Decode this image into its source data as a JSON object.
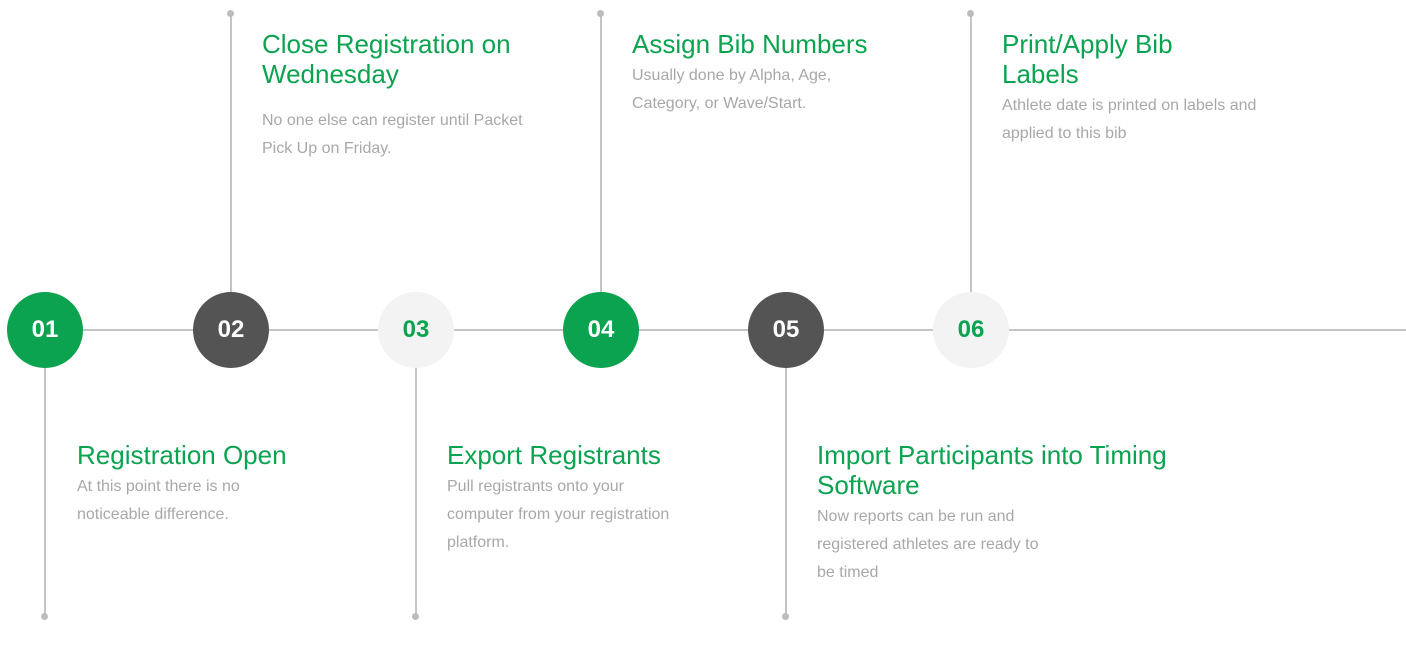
{
  "colors": {
    "green": "#0ba350",
    "dark": "#545454",
    "light": "#f3f3f3",
    "line": "#c4c4c4",
    "title_text": "#0ba350",
    "desc_text": "#a8a8a8"
  },
  "steps": [
    {
      "number": "01",
      "style": "green",
      "title": "Registration Open",
      "description": "At this point there is no noticeable difference."
    },
    {
      "number": "02",
      "style": "dark",
      "title": "Close Registration on Wednesday",
      "description": "No one else can register until Packet Pick Up on Friday."
    },
    {
      "number": "03",
      "style": "light",
      "title": "Export Registrants",
      "description": "Pull registrants onto your computer from your registration platform."
    },
    {
      "number": "04",
      "style": "green",
      "title": "Assign Bib Numbers",
      "description": "Usually done by Alpha, Age, Category, or Wave/Start."
    },
    {
      "number": "05",
      "style": "dark",
      "title": "Import Participants into Timing Software",
      "description": "Now reports can be run and registered athletes are ready to be timed"
    },
    {
      "number": "06",
      "style": "light",
      "title": "Print/Apply Bib Labels",
      "description": "Athlete date is printed on labels and applied to this bib"
    }
  ]
}
